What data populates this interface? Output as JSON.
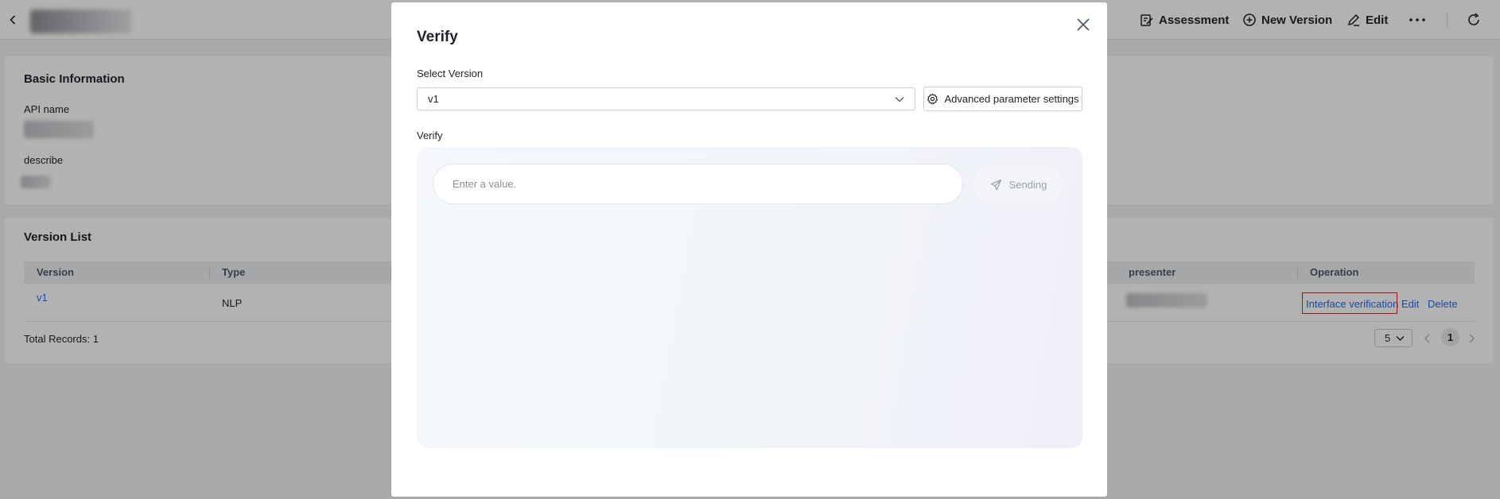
{
  "header": {
    "actions": {
      "assessment": "Assessment",
      "new_version": "New Version",
      "edit": "Edit"
    }
  },
  "basic_info": {
    "title": "Basic Information",
    "api_name_label": "API name",
    "describe_label": "describe"
  },
  "version_list": {
    "title": "Version List",
    "columns": [
      "Version",
      "Type",
      "presenter",
      "Operation"
    ],
    "rows": [
      {
        "version": "v1",
        "type": "NLP"
      }
    ],
    "operations": {
      "interface_verification": "Interface verification",
      "edit": "Edit",
      "delete": "Delete"
    },
    "total_records": "Total Records: 1",
    "page_size": "5",
    "current_page": "1"
  },
  "modal": {
    "title": "Verify",
    "select_version_label": "Select Version",
    "selected_version": "v1",
    "advanced_button": "Advanced parameter settings",
    "verify_label": "Verify",
    "input_placeholder": "Enter a value.",
    "send_button": "Sending"
  },
  "colors": {
    "link": "#1f6ee6",
    "highlight_border": "#e02020",
    "overlay": "rgba(0,0,0,0.3)"
  }
}
